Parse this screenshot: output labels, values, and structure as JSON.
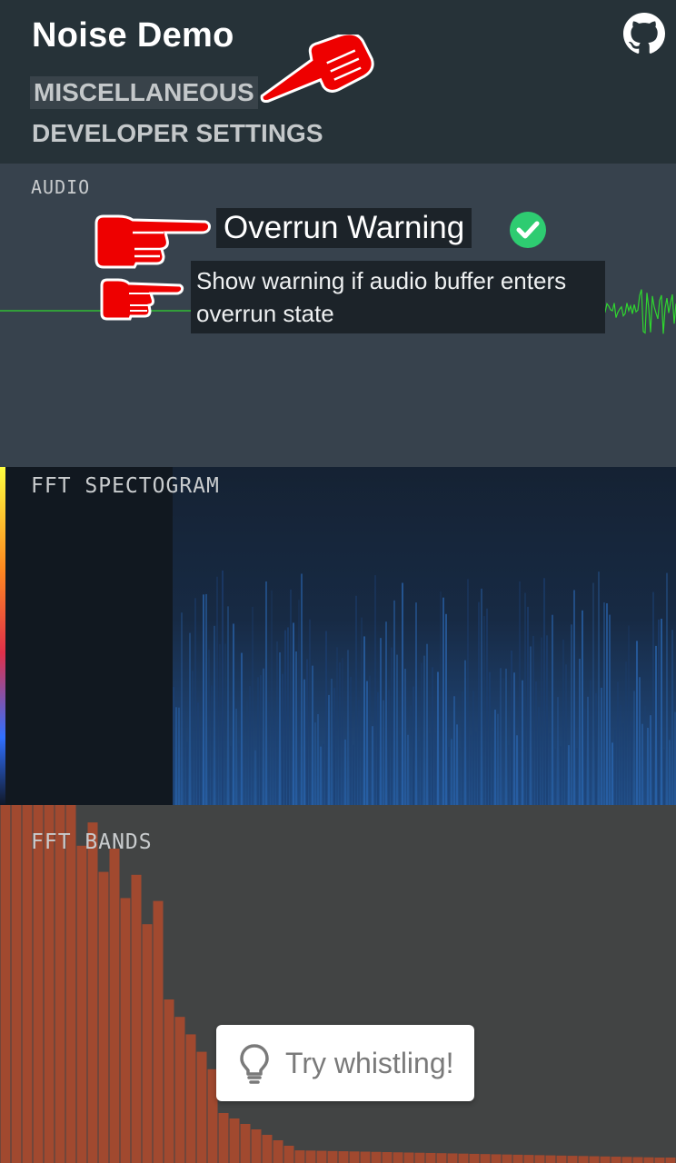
{
  "header": {
    "title": "Noise Demo",
    "github_icon": "github-icon",
    "menu": [
      {
        "label": "MISCELLANEOUS"
      },
      {
        "label": "DEVELOPER SETTINGS"
      }
    ]
  },
  "audio": {
    "label": "AUDIO",
    "setting_title": "Overrun Warning",
    "setting_description": "Show warning if audio buffer enters overrun state",
    "check_icon": "check-circle-icon",
    "enabled": true
  },
  "spectrogram": {
    "label": "FFT SPECTOGRAM"
  },
  "bands": {
    "label": "FFT BANDS"
  },
  "hint": {
    "icon": "lightbulb-icon",
    "text": "Try whistling!"
  },
  "colors": {
    "header_bg": "#263238",
    "audio_bg": "#37424d",
    "spectro_bg": "#111820",
    "bands_bg": "#424444",
    "band_bar": "#b24a2c",
    "waveform": "#2fd62f",
    "check": "#2ecc71",
    "pointer": "#ee0000"
  }
}
